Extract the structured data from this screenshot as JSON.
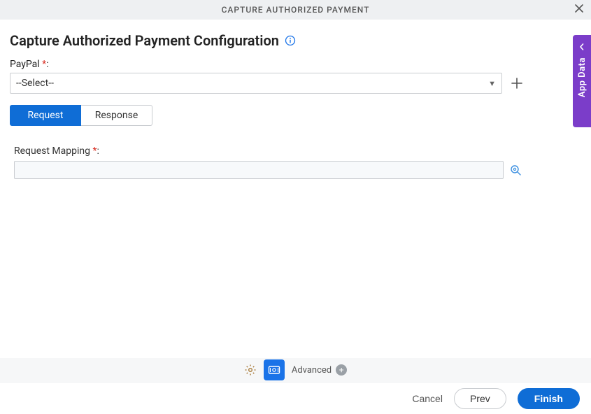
{
  "header": {
    "title": "CAPTURE AUTHORIZED PAYMENT"
  },
  "page": {
    "title": "Capture Authorized Payment Configuration"
  },
  "paypal_field": {
    "label": "PayPal",
    "selected": "--Select--"
  },
  "tabs": {
    "request": "Request",
    "response": "Response"
  },
  "request_mapping": {
    "label": "Request Mapping",
    "value": ""
  },
  "side_tab": {
    "label": "App Data"
  },
  "toolbar": {
    "advanced_label": "Advanced"
  },
  "footer": {
    "cancel": "Cancel",
    "prev": "Prev",
    "finish": "Finish"
  }
}
